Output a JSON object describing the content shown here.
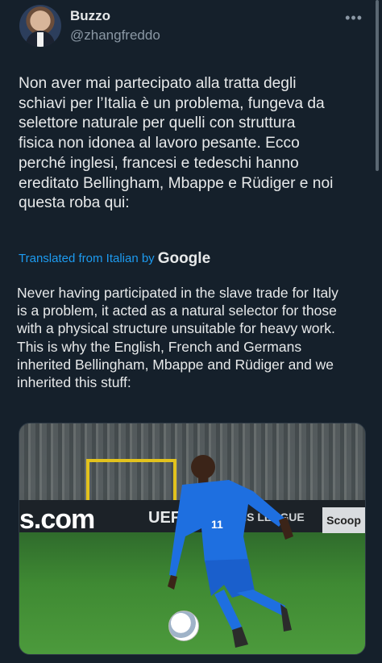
{
  "author": {
    "name": "Buzzo",
    "handle": "@zhangfreddo"
  },
  "more_icon": "more-horizontal-icon",
  "tweet": {
    "original_lines": [
      "Non aver mai partecipato alla tratta degli",
      "schiavi per l’Italia è un problema, fungeva da",
      "selettore naturale per quelli con struttura",
      "fisica non idonea al lavoro pesante. Ecco",
      "perché inglesi, francesi e tedeschi hanno",
      "ereditato Bellingham, Mbappe e Rüdiger e noi",
      "questa roba qui:"
    ],
    "translated_label": "Translated from Italian by",
    "translator": "Google",
    "translation_lines": [
      "Never having participated in the slave trade for Italy",
      "is a problem, it acted as a natural selector for those",
      "with a physical structure unsuitable for heavy work.",
      "This is why the English, French and Germans",
      "inherited Bellingham, Mbappe and Rüdiger and we",
      "inherited this stuff:"
    ]
  },
  "photo": {
    "board_text_1": "s.com",
    "board_text_2": "UEF",
    "board_text_3": "NS LEAGUE",
    "board_text_4": "Scoop",
    "jersey_number": "11"
  },
  "colors": {
    "background": "#15202b",
    "text": "#e7e9ea",
    "secondary": "#8b98a5",
    "link": "#1d9bf0",
    "jersey": "#1e6fe0"
  }
}
